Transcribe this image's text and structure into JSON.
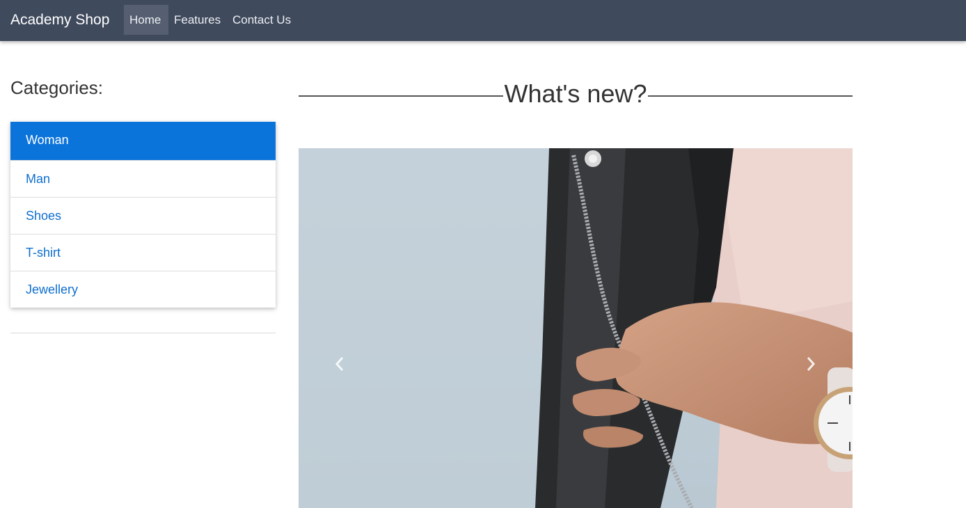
{
  "navbar": {
    "brand": "Academy Shop",
    "items": [
      {
        "label": "Home",
        "active": true
      },
      {
        "label": "Features",
        "active": false
      },
      {
        "label": "Contact Us",
        "active": false
      }
    ],
    "background": "#3f4a5d"
  },
  "sidebar": {
    "heading": "Categories:",
    "categories": [
      {
        "label": "Woman",
        "active": true
      },
      {
        "label": "Man",
        "active": false
      },
      {
        "label": "Shoes",
        "active": false
      },
      {
        "label": "T-shirt",
        "active": false
      },
      {
        "label": "Jewellery",
        "active": false
      }
    ],
    "accent": "#0b74db",
    "link_color": "#0f6fce"
  },
  "main": {
    "section_title": "What's new?",
    "carousel": {
      "image": "woman-leather-jacket-wristwatch-photo",
      "prev_icon": "chevron-left-icon",
      "next_icon": "chevron-right-icon"
    }
  }
}
